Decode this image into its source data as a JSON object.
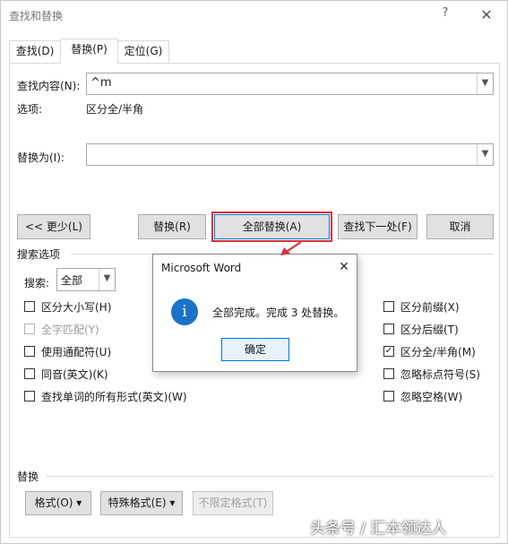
{
  "window": {
    "title": "查找和替换",
    "help": "?",
    "close": "✕"
  },
  "tabs": [
    {
      "label": "查找(D)",
      "active": false
    },
    {
      "label": "替换(P)",
      "active": true
    },
    {
      "label": "定位(G)",
      "active": false
    }
  ],
  "find": {
    "label": "查找内容(N):",
    "value": "^m",
    "options_label": "选项:",
    "options_value": "区分全/半角"
  },
  "replace": {
    "label": "替换为(I):",
    "value": ""
  },
  "buttons": {
    "less": "<< 更少(L)",
    "replace": "替换(R)",
    "replace_all": "全部替换(A)",
    "find_next": "查找下一处(F)",
    "cancel": "取消"
  },
  "search_options": {
    "title": "搜索选项",
    "search_label": "搜索:",
    "search_value": "全部",
    "left_checks": [
      {
        "label": "区分大小写(H)",
        "checked": false,
        "disabled": false
      },
      {
        "label": "全字匹配(Y)",
        "checked": false,
        "disabled": true
      },
      {
        "label": "使用通配符(U)",
        "checked": false,
        "disabled": false
      },
      {
        "label": "同音(英文)(K)",
        "checked": false,
        "disabled": false
      },
      {
        "label": "查找单词的所有形式(英文)(W)",
        "checked": false,
        "disabled": false
      }
    ],
    "right_checks": [
      {
        "label": "区分前缀(X)",
        "checked": false
      },
      {
        "label": "区分后缀(T)",
        "checked": false
      },
      {
        "label": "区分全/半角(M)",
        "checked": true
      },
      {
        "label": "忽略标点符号(S)",
        "checked": false
      },
      {
        "label": "忽略空格(W)",
        "checked": false
      }
    ]
  },
  "replace_section": {
    "title": "替换",
    "format": "格式(O) ▾",
    "special": "特殊格式(E) ▾",
    "no_format": "不限定格式(T)"
  },
  "message_box": {
    "title": "Microsoft Word",
    "close": "✕",
    "icon": "info-icon",
    "text": "全部完成。完成 3 处替换。",
    "ok": "确定"
  },
  "watermark": "头条号 / 汇本领达人",
  "colors": {
    "accent": "#0078d7",
    "highlight": "#d6323b",
    "info": "#1a73c9"
  }
}
